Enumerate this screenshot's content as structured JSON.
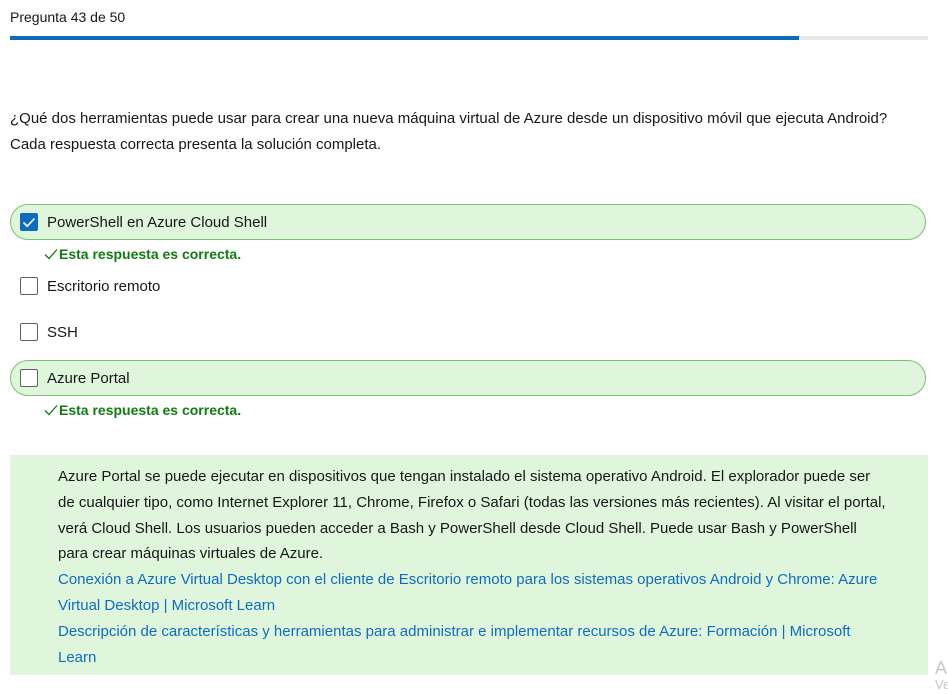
{
  "header": {
    "counter": "Pregunta 43 de 50",
    "progress_fraction": 0.86
  },
  "question": {
    "text": "¿Qué dos herramientas puede usar para crear una nueva máquina virtual de Azure desde un dispositivo móvil que ejecuta Android? Cada respuesta correcta presenta la solución completa."
  },
  "options": [
    {
      "label": "PowerShell en Azure Cloud Shell",
      "checked": true,
      "correct": true
    },
    {
      "label": "Escritorio remoto",
      "checked": false,
      "correct": false
    },
    {
      "label": "SSH",
      "checked": false,
      "correct": false
    },
    {
      "label": "Azure Portal",
      "checked": false,
      "correct": true
    }
  ],
  "feedback": {
    "correct_text": "Esta respuesta es correcta."
  },
  "explanation": {
    "text": "Azure Portal se puede ejecutar en dispositivos que tengan instalado el sistema operativo Android. El explorador puede ser de cualquier tipo, como Internet Explorer 11, Chrome, Firefox o Safari (todas las versiones más recientes). Al visitar el portal, verá Cloud Shell. Los usuarios pueden acceder a Bash y PowerShell desde Cloud Shell. Puede usar Bash y PowerShell para crear máquinas virtuales de Azure.",
    "links": [
      "Conexión a Azure Virtual Desktop con el cliente de Escritorio remoto para los sistemas operativos Android y Chrome: Azure Virtual Desktop | Microsoft Learn",
      "Descripción de características y herramientas para administrar e implementar recursos de Azure: Formación | Microsoft Learn"
    ]
  },
  "corner": {
    "line1": "A",
    "line2": "Ve"
  },
  "colors": {
    "accent": "#0f6cbd",
    "correct_bg": "#dff6dd",
    "correct_border": "#7dbf75",
    "correct_text": "#107c10"
  }
}
